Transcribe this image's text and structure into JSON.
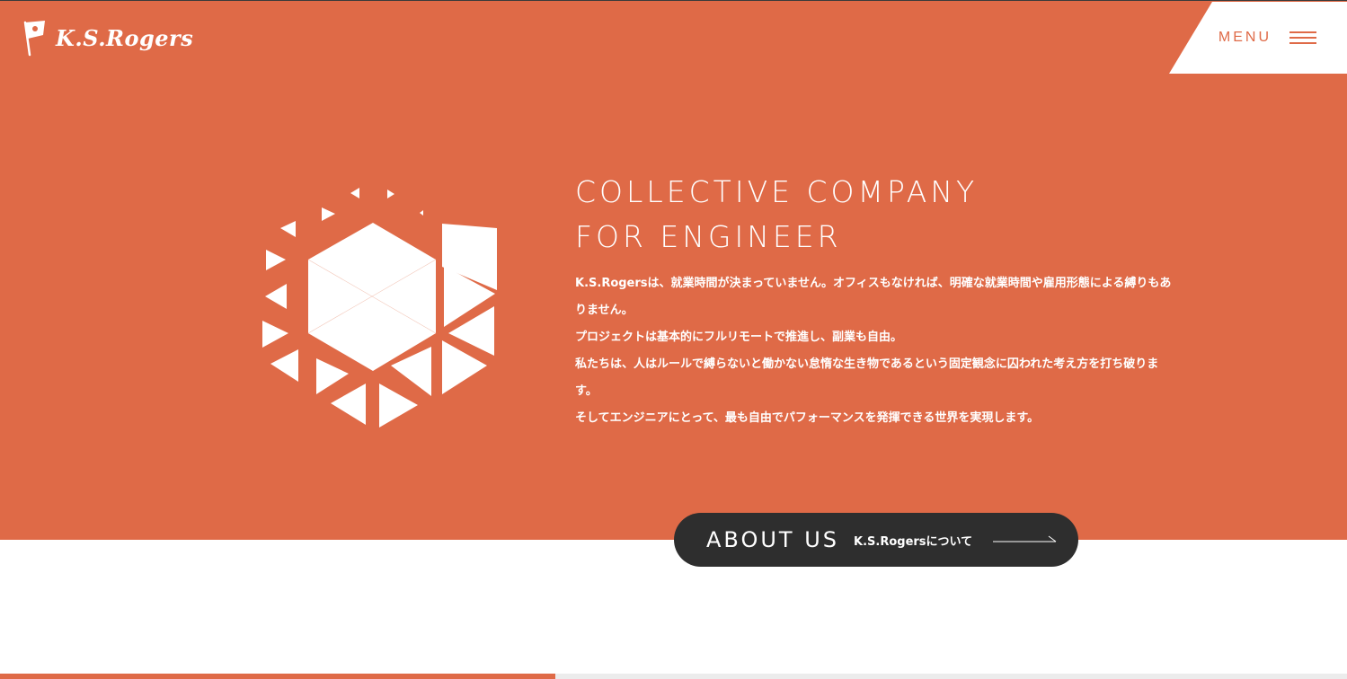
{
  "brand": {
    "name": "K.S.Rogers",
    "logo_icon": "flag-icon"
  },
  "header": {
    "menu_label": "MENU",
    "menu_icon": "hamburger-icon"
  },
  "colors": {
    "accent": "#df6a47",
    "dark": "#2e2e2e",
    "white": "#ffffff"
  },
  "hero": {
    "headline_line1": "COLLECTIVE COMPANY",
    "headline_line2": "FOR ENGINEER",
    "paragraphs": [
      "K.S.Rogersは、就業時間が決まっていません。オフィスもなければ、明確な就業時間や雇用形態による縛りもありません。",
      "プロジェクトは基本的にフルリモートで推進し、副業も自由。",
      "私たちは、人はルールで縛らないと働かない怠惰な生き物であるという固定観念に囚われた考え方を打ち破ります。",
      "そしてエンジニアにとって、最も自由でパフォーマンスを発揮できる世界を実現します。"
    ],
    "graphic_icon": "hexagon-triangles-icon"
  },
  "about_button": {
    "title": "ABOUT US",
    "subtitle": "K.S.Rogersについて",
    "arrow_icon": "arrow-right-icon"
  }
}
